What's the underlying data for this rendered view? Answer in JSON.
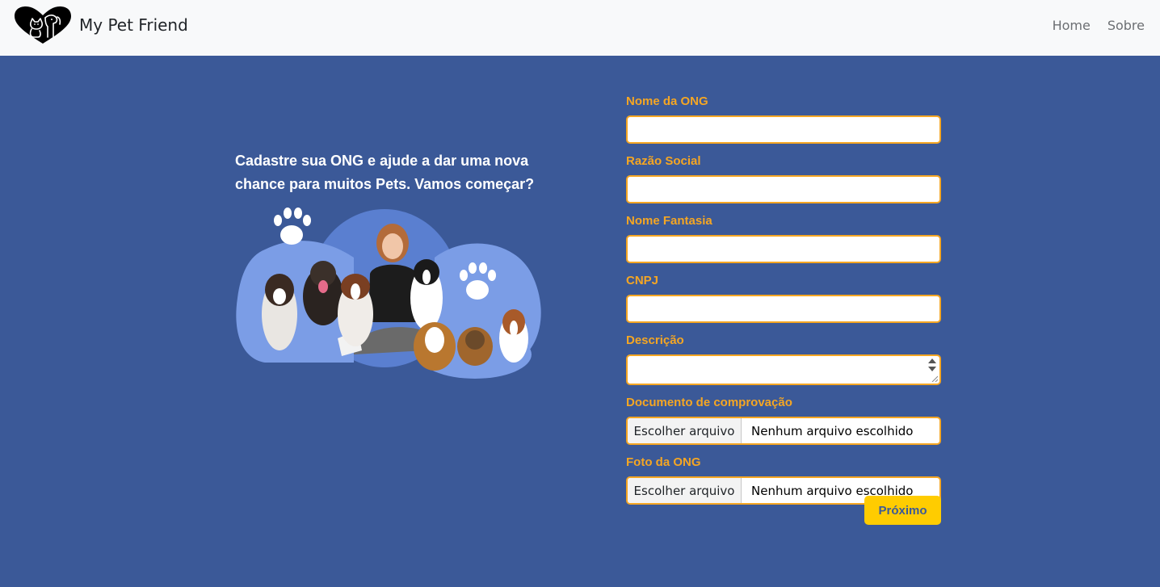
{
  "navbar": {
    "brand": "My Pet Friend",
    "links": [
      "Home",
      "Sobre"
    ]
  },
  "hero": {
    "text": "Cadastre sua ONG e ajude a dar uma nova chance para muitos Pets. Vamos começar?"
  },
  "form": {
    "fields": [
      {
        "label": "Nome da ONG",
        "value": ""
      },
      {
        "label": "Razão Social",
        "value": ""
      },
      {
        "label": "Nome Fantasia",
        "value": ""
      },
      {
        "label": "CNPJ",
        "value": ""
      },
      {
        "label": "Descrição",
        "value": ""
      }
    ],
    "files": [
      {
        "label": "Documento de comprovação",
        "button": "Escolher arquivo",
        "status": "Nenhum arquivo escolhido"
      },
      {
        "label": "Foto da ONG",
        "button": "Escolher arquivo",
        "status": "Nenhum arquivo escolhido"
      }
    ],
    "submit_label": "Próximo"
  },
  "colors": {
    "navbar_bg": "#f8f9fa",
    "page_bg": "#3b5998",
    "label": "#f5a623",
    "input_border": "#f5a623",
    "button_bg": "#ffcc00",
    "button_text": "#3b5998"
  },
  "icons": {
    "brand_logo": "heart-with-cat-and-dog-logo",
    "paw": "paw-icon"
  }
}
